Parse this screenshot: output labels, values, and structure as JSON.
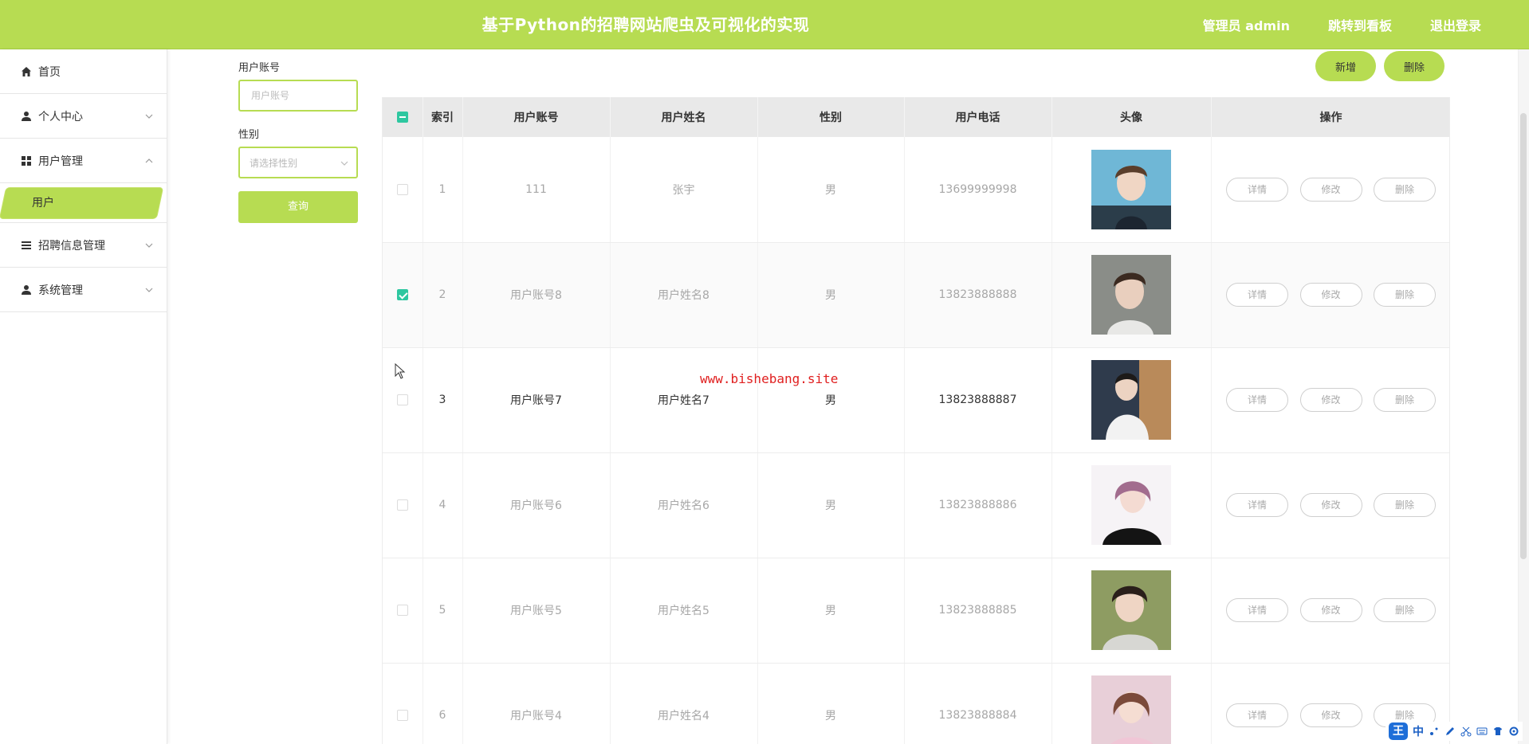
{
  "header": {
    "title": "基于Python的招聘网站爬虫及可视化的实现",
    "admin_label": "管理员 admin",
    "dashboard_link": "跳转到看板",
    "logout_link": "退出登录",
    "bg_color": "#b7dc52"
  },
  "sidebar": {
    "items": [
      {
        "label": "首页",
        "icon": "home-icon"
      },
      {
        "label": "个人中心",
        "icon": "user-icon"
      },
      {
        "label": "用户管理",
        "icon": "grid-icon"
      },
      {
        "label": "招聘信息管理",
        "icon": "list-icon"
      },
      {
        "label": "系统管理",
        "icon": "user-icon"
      }
    ],
    "active_subitem": "用户"
  },
  "search": {
    "account_label": "用户账号",
    "account_placeholder": "用户账号",
    "gender_label": "性别",
    "gender_placeholder": "请选择性别",
    "query_button": "查询"
  },
  "actions": {
    "add_button": "新增",
    "delete_button": "删除"
  },
  "table": {
    "headers": [
      "索引",
      "用户账号",
      "用户姓名",
      "性别",
      "用户电话",
      "头像",
      "操作"
    ],
    "op_labels": {
      "detail": "详情",
      "edit": "修改",
      "delete": "删除"
    },
    "rows": [
      {
        "index": "1",
        "account": "111",
        "name": "张宇",
        "gender": "男",
        "phone": "13699999998",
        "checked": false
      },
      {
        "index": "2",
        "account": "用户账号8",
        "name": "用户姓名8",
        "gender": "男",
        "phone": "13823888888",
        "checked": true
      },
      {
        "index": "3",
        "account": "用户账号7",
        "name": "用户姓名7",
        "gender": "男",
        "phone": "13823888887",
        "checked": false
      },
      {
        "index": "4",
        "account": "用户账号6",
        "name": "用户姓名6",
        "gender": "男",
        "phone": "13823888886",
        "checked": false
      },
      {
        "index": "5",
        "account": "用户账号5",
        "name": "用户姓名5",
        "gender": "男",
        "phone": "13823888885",
        "checked": false
      },
      {
        "index": "6",
        "account": "用户账号4",
        "name": "用户姓名4",
        "gender": "男",
        "phone": "13823888884",
        "checked": false
      }
    ]
  },
  "watermark": "www.bishebang.site",
  "ime": {
    "logo": "王",
    "mode": "中"
  }
}
